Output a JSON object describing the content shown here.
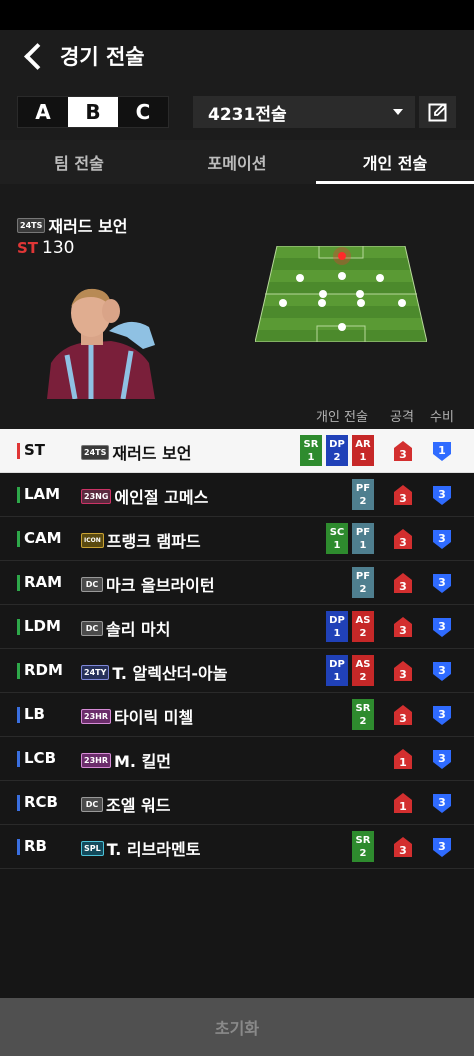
{
  "header": {
    "title": "경기 전술"
  },
  "tactic_sets": [
    {
      "label": "A"
    },
    {
      "label": "B"
    },
    {
      "label": "C"
    }
  ],
  "tactic_dropdown": {
    "value": "4231전술"
  },
  "tabs": [
    {
      "label": "팀 전술"
    },
    {
      "label": "포메이션"
    },
    {
      "label": "개인 전술"
    }
  ],
  "selected_player": {
    "badge": "24TS",
    "name": "재러드 보언",
    "position": "ST",
    "ovr": "130"
  },
  "list_header": {
    "tactic": "개인 전술",
    "attack": "공격",
    "defense": "수비"
  },
  "colors": {
    "forward": "#e03636",
    "midfield": "#2ea84a",
    "defense": "#3a6fe0",
    "attack_shield": "#d32f2f",
    "defense_shield": "#2f6bff"
  },
  "players": [
    {
      "pos": "ST",
      "badge": "24TS",
      "name": "재러드 보언",
      "tags": [
        {
          "code": "SR",
          "level": "1"
        },
        {
          "code": "DP",
          "level": "2"
        },
        {
          "code": "AR",
          "level": "1"
        }
      ],
      "attack": "3",
      "defense": "1"
    },
    {
      "pos": "LAM",
      "badge": "23NG",
      "name": "에인절 고메스",
      "tags": [
        {
          "code": "PF",
          "level": "2"
        }
      ],
      "attack": "3",
      "defense": "3"
    },
    {
      "pos": "CAM",
      "badge": "ICON",
      "name": "프랭크 램파드",
      "tags": [
        {
          "code": "SC",
          "level": "1"
        },
        {
          "code": "PF",
          "level": "1"
        }
      ],
      "attack": "3",
      "defense": "3"
    },
    {
      "pos": "RAM",
      "badge": "DC",
      "name": "마크 올브라이턴",
      "tags": [
        {
          "code": "PF",
          "level": "2"
        }
      ],
      "attack": "3",
      "defense": "3"
    },
    {
      "pos": "LDM",
      "badge": "DC",
      "name": "솔리 마치",
      "tags": [
        {
          "code": "DP",
          "level": "1"
        },
        {
          "code": "AS",
          "level": "2"
        }
      ],
      "attack": "3",
      "defense": "3"
    },
    {
      "pos": "RDM",
      "badge": "24TY",
      "name": "T. 알렉산더-아놀",
      "tags": [
        {
          "code": "DP",
          "level": "1"
        },
        {
          "code": "AS",
          "level": "2"
        }
      ],
      "attack": "3",
      "defense": "3"
    },
    {
      "pos": "LB",
      "badge": "23HR",
      "name": "타이릭 미첼",
      "tags": [
        {
          "code": "SR",
          "level": "2"
        }
      ],
      "attack": "3",
      "defense": "3"
    },
    {
      "pos": "LCB",
      "badge": "23HR",
      "name": "M. 킬먼",
      "tags": [],
      "attack": "1",
      "defense": "3"
    },
    {
      "pos": "RCB",
      "badge": "DC",
      "name": "조엘 워드",
      "tags": [],
      "attack": "1",
      "defense": "3"
    },
    {
      "pos": "RB",
      "badge": "SPL",
      "name": "T. 리브라멘토",
      "tags": [
        {
          "code": "SR",
          "level": "2"
        }
      ],
      "attack": "3",
      "defense": "3"
    }
  ],
  "footer": {
    "reset_label": "초기화"
  }
}
